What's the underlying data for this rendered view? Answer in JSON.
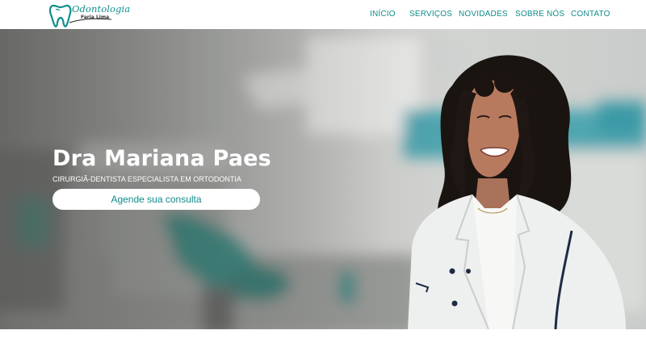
{
  "brand": {
    "name": "Odontologia",
    "subtitle": "Faria Lima",
    "accent_color": "#0f8c8a",
    "logo_icon": "tooth-icon"
  },
  "nav": {
    "items": [
      {
        "label": "INÍCIO"
      },
      {
        "label": "SERVIÇOS"
      },
      {
        "label": "NOVIDADES"
      },
      {
        "label": "SOBRE NÓS"
      },
      {
        "label": "CONTATO"
      }
    ]
  },
  "hero": {
    "title": "Dra Mariana Paes",
    "subtitle": "CIRURGIÃ-DENTISTA ESPECIALISTA EM ORTODONTIA",
    "cta_label": "Agende sua consulta"
  }
}
